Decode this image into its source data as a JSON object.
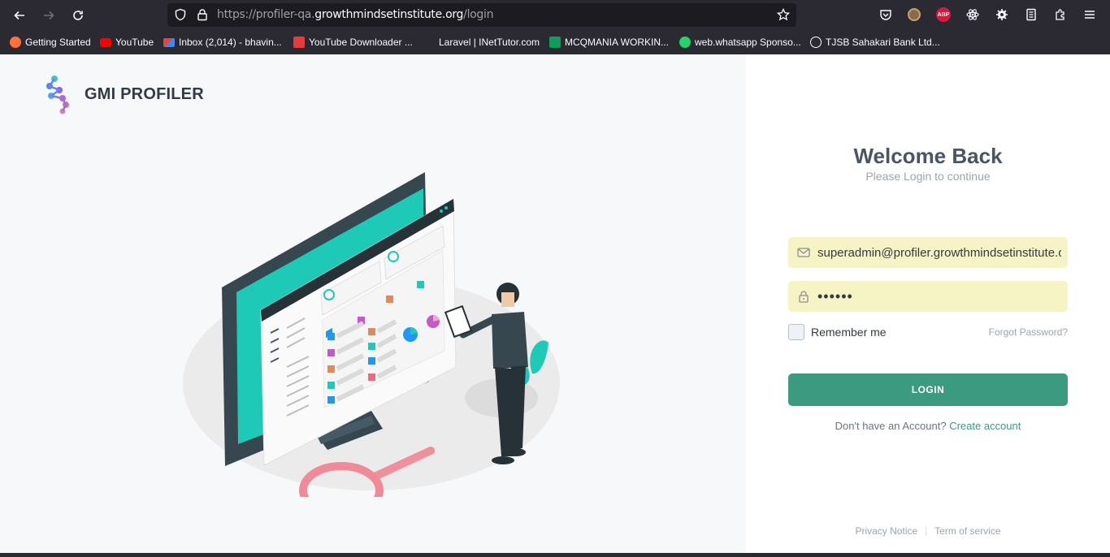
{
  "browser": {
    "url_prefix": "https://profiler-qa.",
    "url_host": "growthmindsetinstitute.org",
    "url_path": "/login",
    "bookmarks": [
      {
        "label": "Getting Started",
        "icon": "firefox-icon",
        "color": "#ff7139"
      },
      {
        "label": "YouTube",
        "icon": "youtube-icon",
        "color": "#ff0000"
      },
      {
        "label": "Inbox (2,014) - bhavin...",
        "icon": "gmail-icon",
        "color": "#ea4335"
      },
      {
        "label": "YouTube Downloader ...",
        "icon": "download-icon",
        "color": "#e53b3b"
      },
      {
        "label": "Laravel | INetTutor.com",
        "icon": "blank-icon",
        "color": "#2b2a33"
      },
      {
        "label": "MCQMANIA WORKIN...",
        "icon": "sheets-icon",
        "color": "#0f9d58"
      },
      {
        "label": "web.whatsapp Sponso...",
        "icon": "whatsapp-icon",
        "color": "#25d366"
      },
      {
        "label": "TJSB Sahakari Bank Ltd...",
        "icon": "globe-icon",
        "color": "#fbfbfe"
      }
    ],
    "abp_label": "ABP"
  },
  "brand": {
    "name": "GMI PROFILER"
  },
  "login": {
    "title": "Welcome Back",
    "subtitle": "Please Login to continue",
    "email_value": "superadmin@profiler.growthmindsetinstitute.org",
    "password_value": "••••••",
    "remember_label": "Remember me",
    "forgot_label": "Forgot Password?",
    "submit_label": "LOGIN",
    "signup_prompt": "Don't have an Account?",
    "signup_link": "Create account"
  },
  "footer": {
    "privacy": "Privacy Notice",
    "terms": "Term of service"
  },
  "colors": {
    "accent": "#3c9a80",
    "teal": "#1ec9b7",
    "input_bg": "#f6f3c4"
  }
}
